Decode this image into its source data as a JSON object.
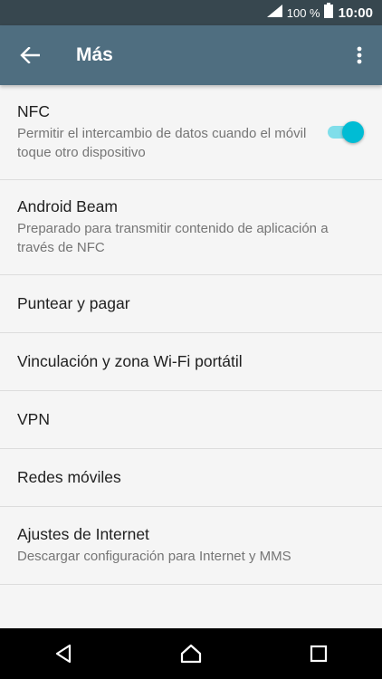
{
  "status_bar": {
    "battery_percent": "100 %",
    "time": "10:00"
  },
  "app_bar": {
    "title": "Más"
  },
  "items": [
    {
      "title": "NFC",
      "subtitle": "Permitir el intercambio de datos cuando el móvil toque otro dispositivo",
      "toggle_on": true
    },
    {
      "title": "Android Beam",
      "subtitle": "Preparado para transmitir contenido de aplicación a través de NFC"
    },
    {
      "title": "Puntear y pagar"
    },
    {
      "title": "Vinculación y zona Wi-Fi portátil"
    },
    {
      "title": "VPN"
    },
    {
      "title": "Redes móviles"
    },
    {
      "title": "Ajustes de Internet",
      "subtitle": "Descargar configuración para Internet y MMS"
    }
  ],
  "colors": {
    "status_bar": "#37474f",
    "app_bar": "#4f6e80",
    "accent": "#00bcd4"
  }
}
